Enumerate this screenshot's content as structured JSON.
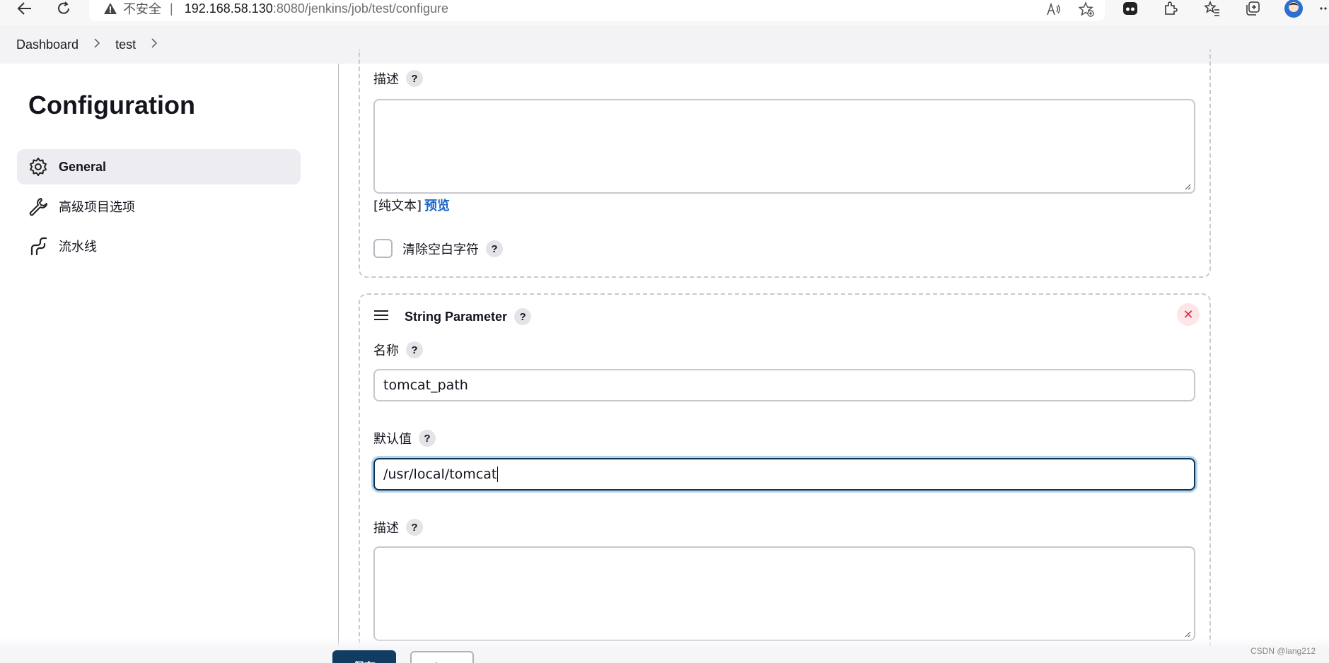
{
  "browser": {
    "insecure_label": "不安全",
    "separator": "|",
    "url_host": "192.168.58.130",
    "url_rest": ":8080/jenkins/job/test/configure",
    "read_aloud_icon": "Á"
  },
  "breadcrumb": {
    "items": [
      "Dashboard",
      "test"
    ],
    "separator": ">"
  },
  "sidebar": {
    "title": "Configuration",
    "items": [
      {
        "label": "General",
        "icon": "gear-icon",
        "active": true
      },
      {
        "label": "高级项目选项",
        "icon": "wrench-icon",
        "active": false
      },
      {
        "label": "流水线",
        "icon": "pipeline-icon",
        "active": false
      }
    ]
  },
  "section1": {
    "description_label": "描述",
    "help": "?",
    "plain_text_label": "[纯文本]",
    "preview_label": "预览",
    "trim_label": "清除空白字符"
  },
  "section2": {
    "title": "String Parameter",
    "help": "?",
    "close": "✕",
    "name_label": "名称",
    "name_value": "tomcat_path",
    "default_label": "默认值",
    "default_value": "/usr/local/tomcat",
    "description_label": "描述"
  },
  "footer": {
    "save_label": "保存",
    "apply_label": "应用"
  },
  "watermark": "CSDN @lang212",
  "colors": {
    "accent": "#123c62",
    "link": "#1b66c9",
    "danger": "#e22b3c"
  }
}
